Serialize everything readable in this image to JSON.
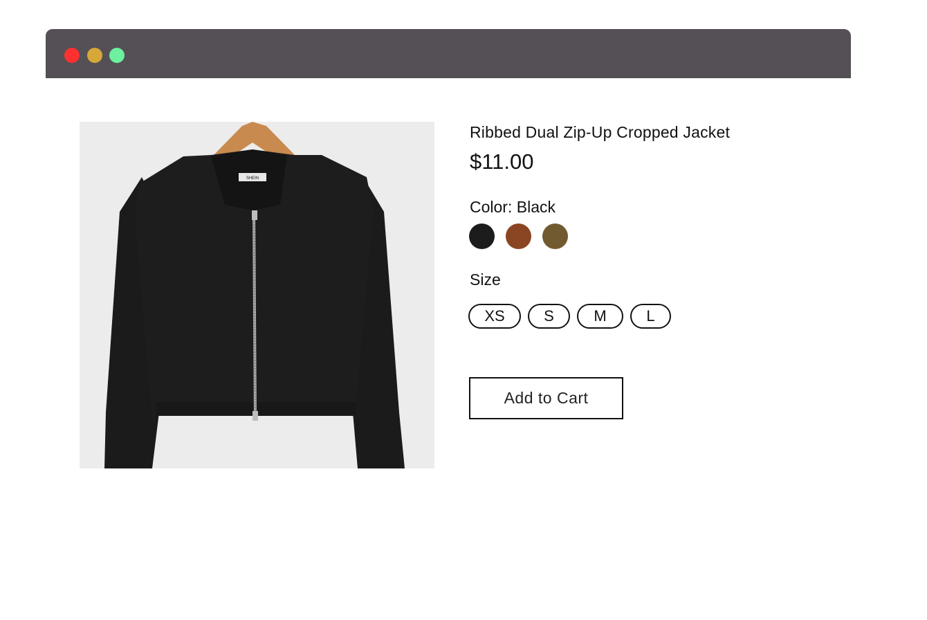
{
  "window": {
    "controls": [
      {
        "name": "close-dot",
        "color": "#fe3030"
      },
      {
        "name": "minimize-dot",
        "color": "#d6a83a"
      },
      {
        "name": "zoom-dot",
        "color": "#6df09f"
      }
    ]
  },
  "product": {
    "image_icon": "black-zip-up-hooded-jacket-photo",
    "hanger_label": "SHEIN",
    "title": "Ribbed Dual Zip-Up Cropped Jacket",
    "price": "$11.00",
    "color_label": "Color: Black",
    "colors": [
      {
        "name": "Black",
        "hex": "#1c1c1c"
      },
      {
        "name": "Brown",
        "hex": "#8a4522"
      },
      {
        "name": "Olive",
        "hex": "#725a30"
      }
    ],
    "size_label": "Size",
    "sizes": [
      "XS",
      "S",
      "M",
      "L"
    ],
    "add_to_cart_label": "Add to Cart"
  }
}
